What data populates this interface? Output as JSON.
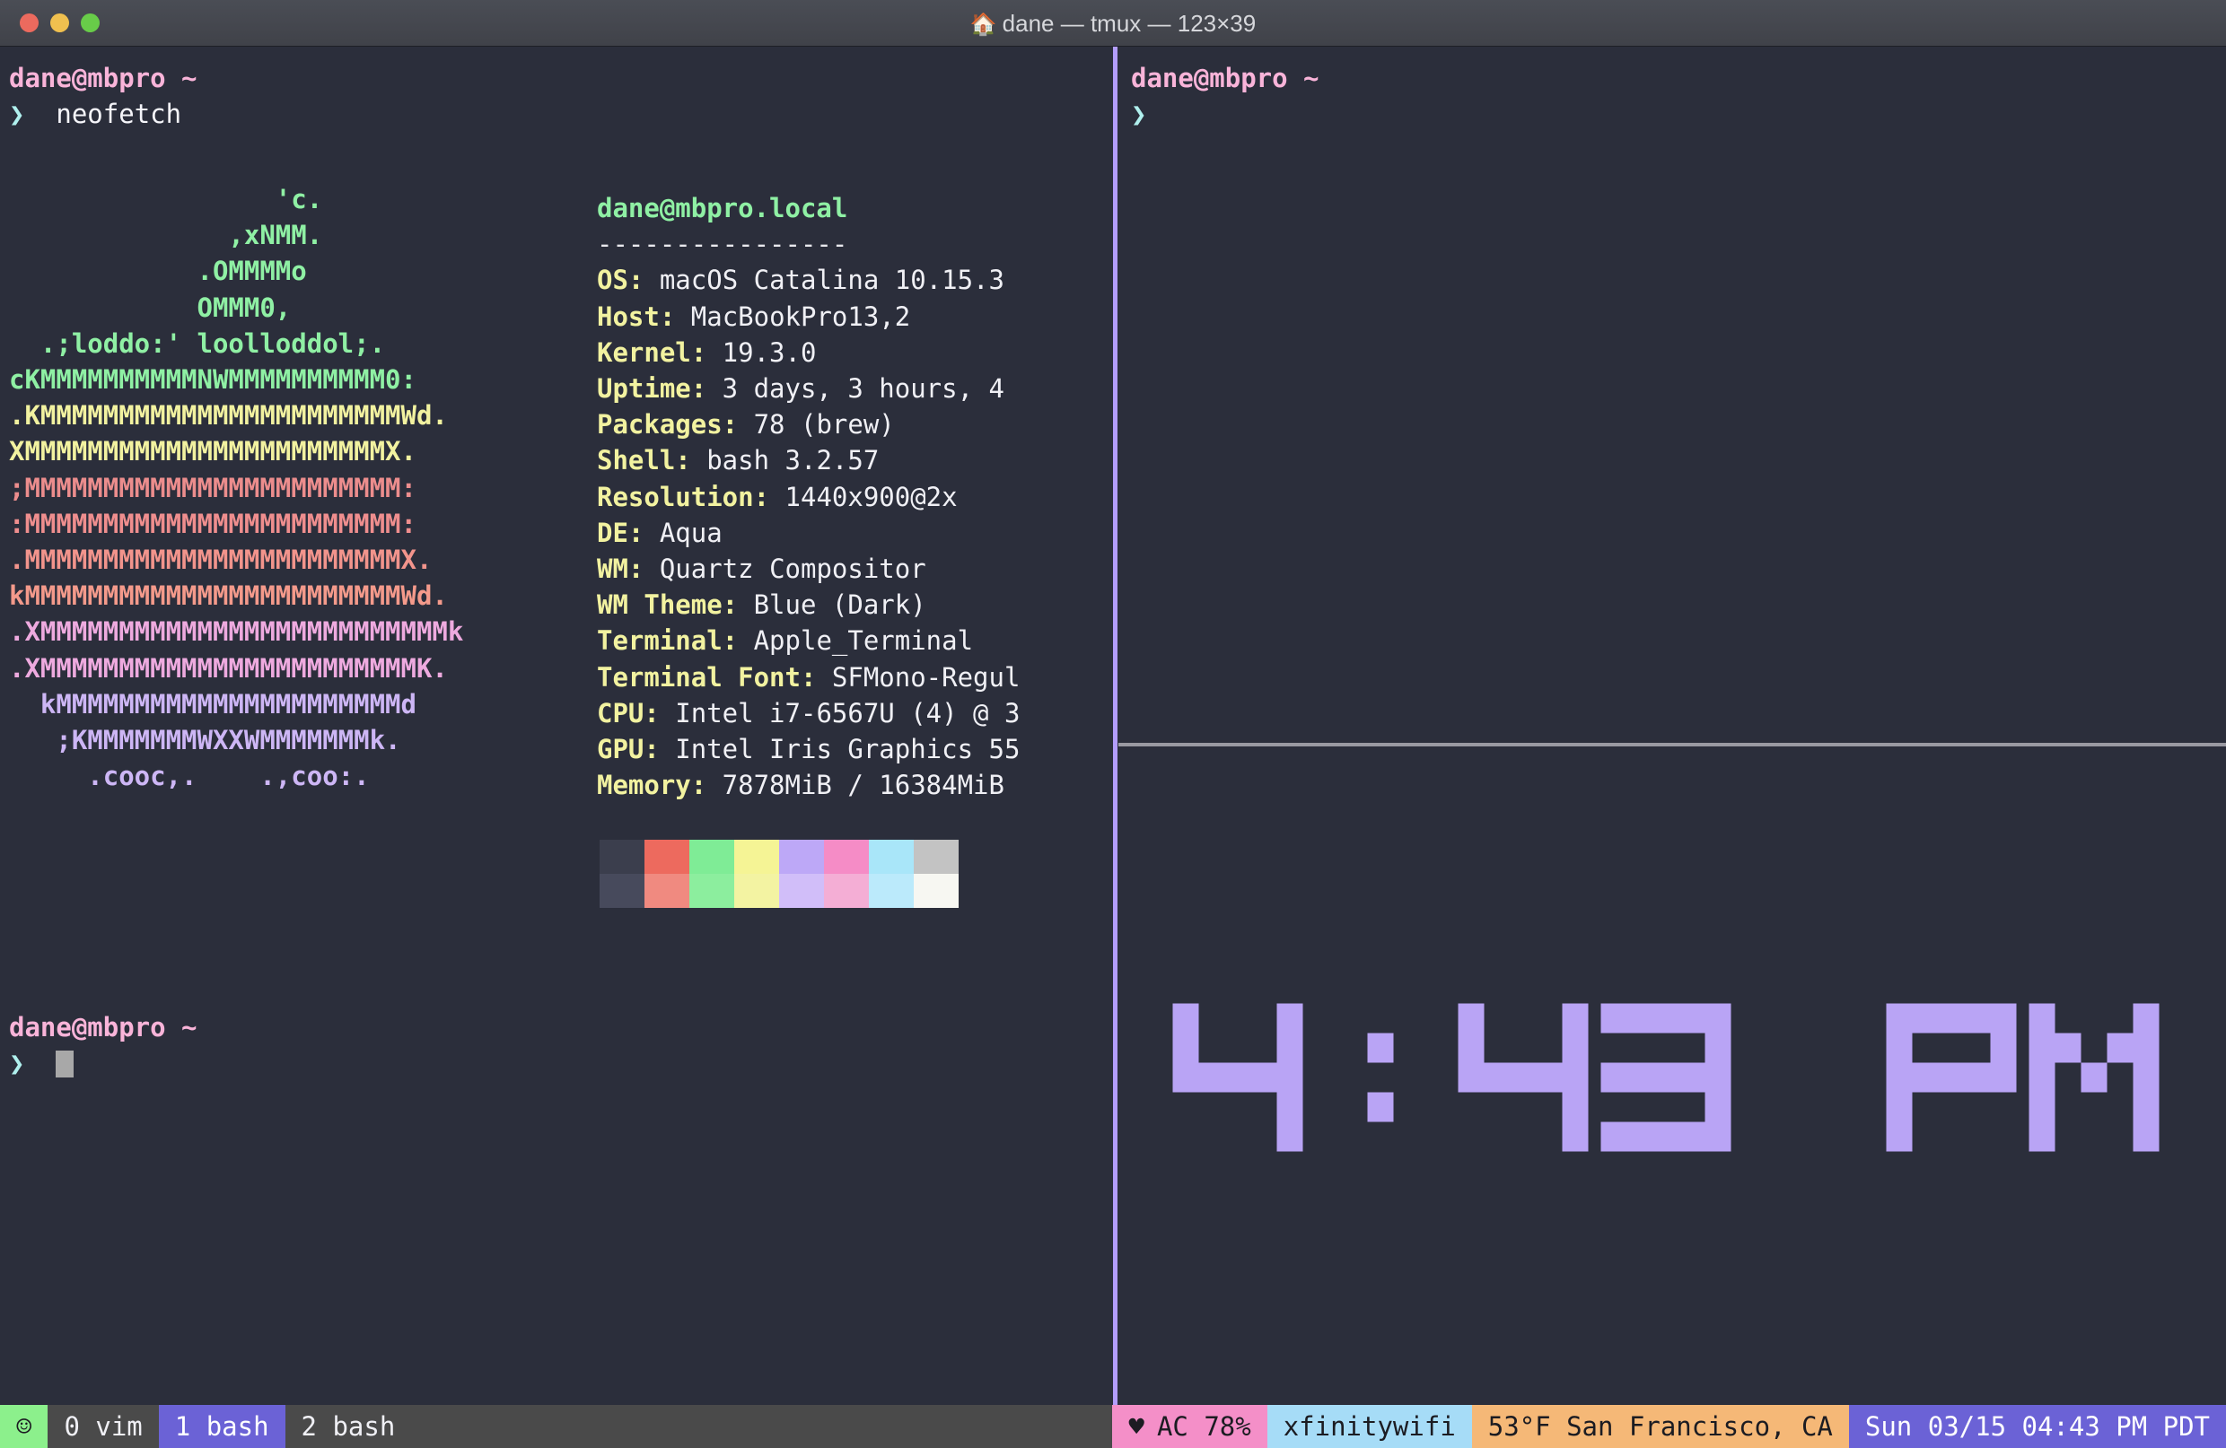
{
  "window": {
    "title": "dane — tmux — 123×39",
    "title_icon": "🏠",
    "icon_name": "house-icon",
    "traffic_lights": [
      "close",
      "minimize",
      "maximize"
    ]
  },
  "panes": {
    "left": {
      "prompt1": {
        "user_host": "dane@mbpro ~",
        "chevron": "❯",
        "command": "neofetch"
      },
      "prompt2": {
        "user_host": "dane@mbpro ~",
        "chevron": "❯",
        "command": ""
      }
    },
    "right_top": {
      "prompt": {
        "user_host": "dane@mbpro ~",
        "chevron": "❯",
        "command": ""
      }
    },
    "right_bottom": {
      "clock_text": "4:43 PM"
    }
  },
  "neofetch": {
    "title": "dane@mbpro.local",
    "rule": "----------------",
    "rows": [
      {
        "key": "OS",
        "value": "macOS Catalina 10.15.3"
      },
      {
        "key": "Host",
        "value": "MacBookPro13,2"
      },
      {
        "key": "Kernel",
        "value": "19.3.0"
      },
      {
        "key": "Uptime",
        "value": "3 days, 3 hours, 4"
      },
      {
        "key": "Packages",
        "value": "78 (brew)"
      },
      {
        "key": "Shell",
        "value": "bash 3.2.57"
      },
      {
        "key": "Resolution",
        "value": "1440x900@2x"
      },
      {
        "key": "DE",
        "value": "Aqua"
      },
      {
        "key": "WM",
        "value": "Quartz Compositor"
      },
      {
        "key": "WM Theme",
        "value": "Blue (Dark)"
      },
      {
        "key": "Terminal",
        "value": "Apple_Terminal"
      },
      {
        "key": "Terminal Font",
        "value": "SFMono-Regul"
      },
      {
        "key": "CPU",
        "value": "Intel i7-6567U (4) @ 3"
      },
      {
        "key": "GPU",
        "value": "Intel Iris Graphics 55"
      },
      {
        "key": "Memory",
        "value": "7878MiB / 16384MiB"
      }
    ],
    "ascii_art": [
      {
        "text": "                 'c.",
        "color": "#8ff0a4"
      },
      {
        "text": "              ,xNMM.",
        "color": "#8ff0a4"
      },
      {
        "text": "            .OMMMMo",
        "color": "#8ff0a4"
      },
      {
        "text": "            OMMM0,",
        "color": "#8ff0a4"
      },
      {
        "text": "  .;loddo:' loolloddol;.",
        "color": "#8ff0a4"
      },
      {
        "text": "cKMMMMMMMMMMNWMMMMMMMMMM0:",
        "color": "#8ff0a4"
      },
      {
        "text": ".KMMMMMMMMMMMMMMMMMMMMMMMWd.",
        "color": "#f2f2a0"
      },
      {
        "text": "XMMMMMMMMMMMMMMMMMMMMMMMX.",
        "color": "#f2f2a0"
      },
      {
        "text": ";MMMMMMMMMMMMMMMMMMMMMMMM:",
        "color": "#ec8d8d"
      },
      {
        "text": ":MMMMMMMMMMMMMMMMMMMMMMMM:",
        "color": "#ef8e8e"
      },
      {
        "text": ".MMMMMMMMMMMMMMMMMMMMMMMMX.",
        "color": "#f2948c"
      },
      {
        "text": "kMMMMMMMMMMMMMMMMMMMMMMMMWd.",
        "color": "#f49a8b"
      },
      {
        "text": ".XMMMMMMMMMMMMMMMMMMMMMMMMMMk",
        "color": "#eeaadf"
      },
      {
        "text": ".XMMMMMMMMMMMMMMMMMMMMMMMMK.",
        "color": "#eeaadf"
      },
      {
        "text": "  kMMMMMMMMMMMMMMMMMMMMMMd",
        "color": "#cdb6f5"
      },
      {
        "text": "   ;KMMMMMMMWXXWMMMMMMMk.",
        "color": "#cdb6f5"
      },
      {
        "text": "     .cooc,.    .,coo:.",
        "color": "#cdb6f5"
      }
    ],
    "palette_row1": [
      "#3b3e4d",
      "#ed6a5e",
      "#7fec96",
      "#f5f495",
      "#bda8f7",
      "#f58cc6",
      "#a9e6f9",
      "#c3c3c3"
    ],
    "palette_row2": [
      "#474a5c",
      "#f08a80",
      "#8cee9e",
      "#f3f3a2",
      "#d1bef9",
      "#f4aed5",
      "#bbeafb",
      "#f7f7f2"
    ]
  },
  "statusbar": {
    "session_icon": "☺",
    "session_icon_name": "smiley-icon",
    "windows": [
      {
        "label": "0 vim",
        "active": false
      },
      {
        "label": "1 bash",
        "active": true
      },
      {
        "label": "2 bash",
        "active": false
      }
    ],
    "battery_icon": "♥",
    "battery": "AC 78%",
    "wifi": "xfinitywifi",
    "weather": "53°F San Francisco, CA",
    "datetime": "Sun 03/15 04:43 PM PDT"
  },
  "colors": {
    "background": "#2b2e3b",
    "pane_border_active": "#b39dfb",
    "pane_border_inactive": "#9a9aa2",
    "clock": "#b9a4f5",
    "prompt_user": "#f9b4d9",
    "prompt_chevron": "#b0f0ee"
  }
}
